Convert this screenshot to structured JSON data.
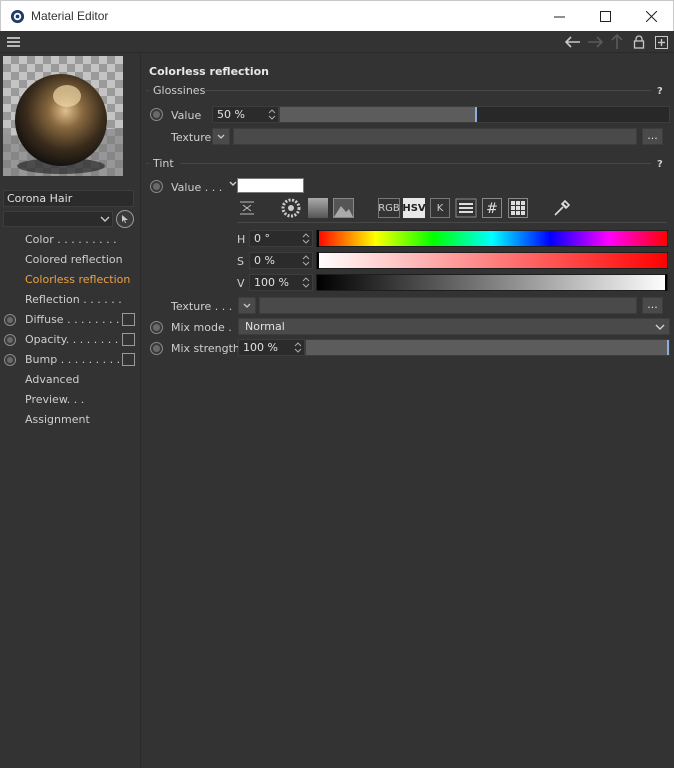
{
  "window": {
    "title": "Material Editor"
  },
  "material": {
    "name": "Corona Hair"
  },
  "channels": [
    {
      "label": "Color . . . . . . . . .",
      "active": false,
      "radio": false,
      "checkbox": false
    },
    {
      "label": "Colored reflection",
      "active": false,
      "radio": false,
      "checkbox": false
    },
    {
      "label": "Colorless reflection",
      "active": true,
      "radio": false,
      "checkbox": false
    },
    {
      "label": "Reflection . . . . . .",
      "active": false,
      "radio": false,
      "checkbox": false
    },
    {
      "label": "Diffuse . . . . . . . . .",
      "active": false,
      "radio": true,
      "checkbox": true
    },
    {
      "label": "Opacity. . . . . . . . .",
      "active": false,
      "radio": true,
      "checkbox": true
    },
    {
      "label": "Bump . . . . . . . . . .",
      "active": false,
      "radio": true,
      "checkbox": true
    },
    {
      "label": "Advanced",
      "active": false,
      "radio": false,
      "checkbox": false
    },
    {
      "label": "Preview. . .",
      "active": false,
      "radio": false,
      "checkbox": false
    },
    {
      "label": "Assignment",
      "active": false,
      "radio": false,
      "checkbox": false
    }
  ],
  "main": {
    "heading": "Colorless reflection",
    "glossiness": {
      "group_label": "Glossines",
      "help": "?",
      "value_label": "Value",
      "value": "50 %",
      "value_fraction": 0.5,
      "texture_label": "Texture",
      "dots": "..."
    },
    "tint": {
      "group_label": "Tint",
      "help": "?",
      "value_label": "Value . . .",
      "swatch_color": "#ffffff",
      "modes": [
        "RGB",
        "HSV",
        "K"
      ],
      "selected_mode": "HSV",
      "h_label": "H",
      "h_value": "0 °",
      "s_label": "S",
      "s_value": "0 %",
      "v_label": "V",
      "v_value": "100 %",
      "texture_label": "Texture . . .",
      "dots": "..."
    },
    "mix_mode": {
      "label": "Mix mode .",
      "value": "Normal"
    },
    "mix_strength": {
      "label": "Mix strength",
      "value": "100 %",
      "value_fraction": 1.0
    }
  },
  "colors": {
    "accent_active": "#f0a040",
    "panel_bg": "#333333",
    "slider_marker": "#8aaee0"
  }
}
